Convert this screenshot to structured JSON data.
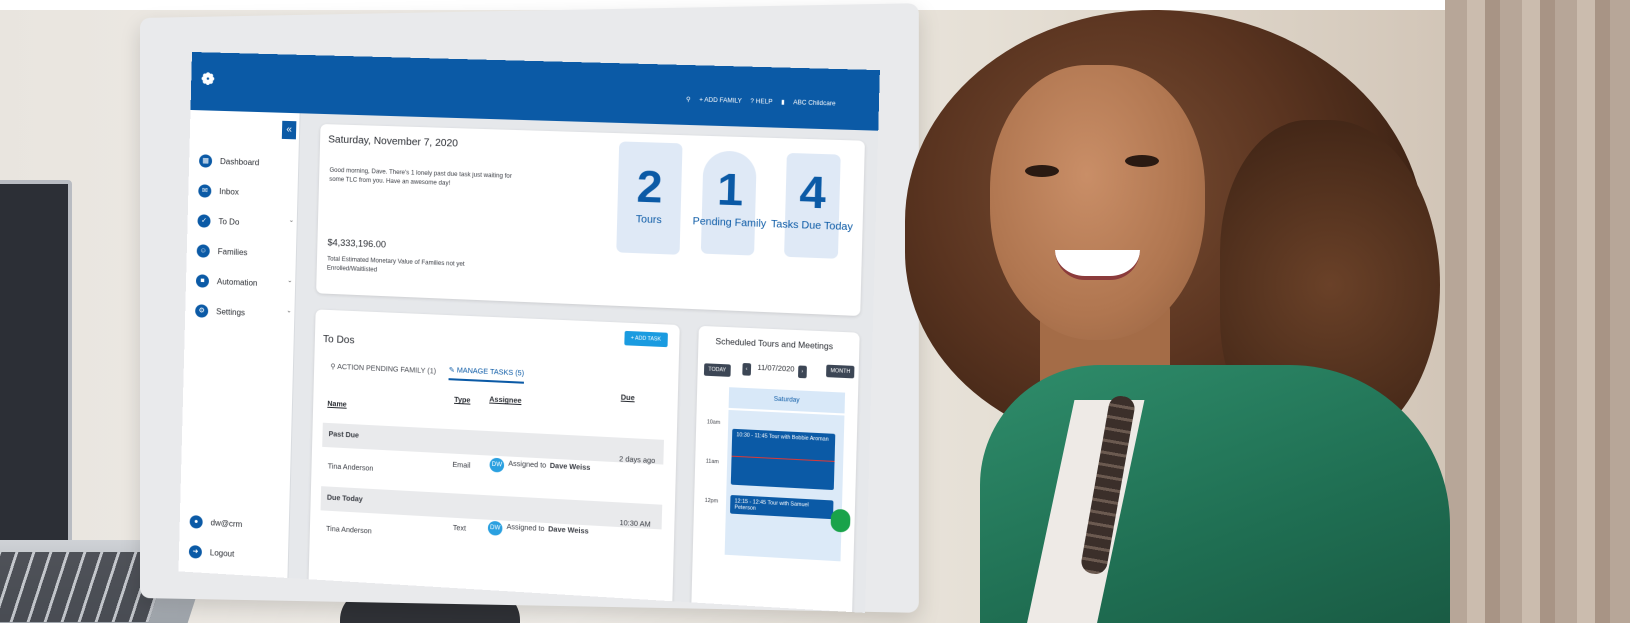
{
  "header": {
    "logo_text": "❁",
    "add_family": "+ ADD FAMILY",
    "help": "? HELP",
    "org_name": "ABC Childcare"
  },
  "sidebar": {
    "collapse": "«",
    "items": [
      {
        "label": "Dashboard",
        "icon": "dashboard-icon",
        "chevron": ""
      },
      {
        "label": "Inbox",
        "icon": "inbox-icon",
        "chevron": ""
      },
      {
        "label": "To Do",
        "icon": "todo-icon",
        "chevron": "ˇ"
      },
      {
        "label": "Families",
        "icon": "families-icon",
        "chevron": ""
      },
      {
        "label": "Automation",
        "icon": "automation-icon",
        "chevron": "ˇ"
      },
      {
        "label": "Settings",
        "icon": "settings-icon",
        "chevron": "ˇ"
      }
    ],
    "user": "dw@crm",
    "logout": "Logout"
  },
  "summary": {
    "date": "Saturday, November 7, 2020",
    "greeting": "Good morning, Dave. There's 1 lonely past due task just waiting for some TLC from you. Have an awesome day!",
    "amount": "$4,333,196.00",
    "amount_caption": "Total Estimated Monetary Value of Families not yet Enrolled/Waitlisted",
    "stats": [
      {
        "value": "2",
        "label": "Tours"
      },
      {
        "value": "1",
        "label": "Pending Family"
      },
      {
        "value": "4",
        "label": "Tasks Due Today"
      }
    ]
  },
  "todos": {
    "title": "To Dos",
    "add_task": "+ ADD TASK",
    "tabs": [
      "ACTION PENDING FAMILY (1)",
      "MANAGE TASKS (5)"
    ],
    "columns": [
      "Name",
      "Type",
      "Assignee",
      "Due"
    ],
    "groups": [
      {
        "label": "Past Due",
        "row": {
          "name": "Tina Anderson",
          "type": "Email",
          "avatar": "DW",
          "assignee_prefix": "Assigned to",
          "assignee": "Dave Weiss",
          "due": "2 days ago"
        }
      },
      {
        "label": "Due Today",
        "row": {
          "name": "Tina Anderson",
          "type": "Text",
          "avatar": "DW",
          "assignee_prefix": "Assigned to",
          "assignee": "Dave Weiss",
          "due": "10:30 AM"
        }
      }
    ]
  },
  "schedule": {
    "title": "Scheduled Tours and Meetings",
    "today": "TODAY",
    "date": "11/07/2020",
    "month": "MONTH",
    "day_header": "Saturday",
    "times": [
      "10am",
      "11am",
      "12pm"
    ],
    "events": [
      "10:30 - 11:45  Tour with Bobbie Aroman",
      "12:15 - 12:45  Tour with Samuel Peterson"
    ]
  },
  "colors": {
    "brand": "#0b5aa6",
    "accent": "#1a9be0",
    "chat": "#19a34a"
  }
}
